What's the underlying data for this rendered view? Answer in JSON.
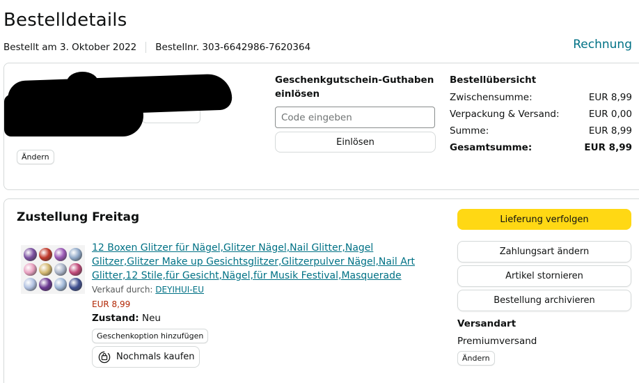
{
  "header": {
    "title": "Bestelldetails",
    "ordered_on": "Bestellt am 3. Oktober 2022",
    "order_number": "Bestellnr. 303-6642986-7620364",
    "invoice_link": "Rechnung"
  },
  "address_section": {
    "change_label": "Ändern"
  },
  "gift_card": {
    "title": "Geschenkgutschein-Guthaben einlösen",
    "input_placeholder": "Code eingeben",
    "input_value": "",
    "redeem_label": "Einlösen"
  },
  "summary": {
    "title": "Bestellübersicht",
    "rows": [
      {
        "label": "Zwischensumme:",
        "value": "EUR 8,99"
      },
      {
        "label": "Verpackung & Versand:",
        "value": "EUR 0,00"
      },
      {
        "label": "Summe:",
        "value": "EUR 8,99"
      },
      {
        "label": "Gesamtsumme:",
        "value": "EUR 8,99"
      }
    ]
  },
  "delivery": {
    "title": "Zustellung Freitag",
    "product": {
      "name": "12 Boxen Glitzer für Nägel,Glitzer Nägel,Nail Glitter,Nagel Glitzer,Glitzer Make up Gesichtsglitzer,Glitzerpulver Nägel,Nail Art Glitter,12 Stile,für Gesicht,Nägel,für Musik Festival,Masquerade",
      "seller_prefix": "Verkauf durch:",
      "seller_name": "DEYIHUI-EU",
      "price": "EUR 8,99",
      "condition_label": "Zustand:",
      "condition_value": "Neu",
      "jar_colors": [
        "#7a4fa0",
        "#c0392b",
        "#9b59b6",
        "#8fa8c8",
        "#e8a0c0",
        "#d4b870",
        "#aab4c8",
        "#c04878",
        "#b0c0e0",
        "#6a3890",
        "#a0b8d8",
        "#405090"
      ]
    },
    "gift_option_label": "Geschenkoption hinzufügen",
    "buy_again_label": "Nochmals kaufen",
    "buttons": {
      "track": "Lieferung verfolgen",
      "change_payment": "Zahlungsart ändern",
      "cancel": "Artikel stornieren",
      "archive": "Bestellung archivieren"
    },
    "shipping": {
      "title": "Versandart",
      "value": "Premiumversand",
      "change_label": "Ändern"
    }
  },
  "colors": {
    "link": "#007185",
    "primary_button": "#ffd814",
    "price": "#b12704"
  }
}
